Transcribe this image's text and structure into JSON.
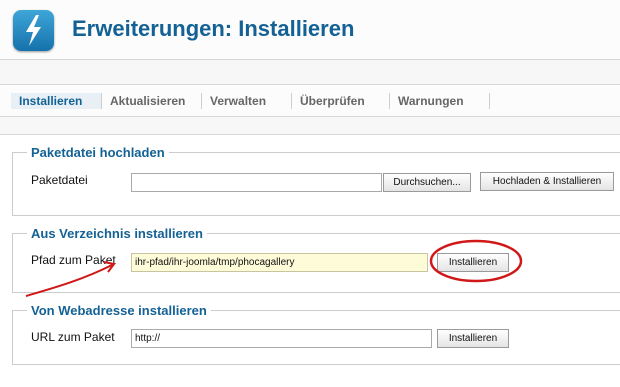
{
  "header": {
    "title": "Erweiterungen: Installieren",
    "icon": "extension-lightning-icon"
  },
  "tabs": [
    {
      "label": "Installieren",
      "active": true
    },
    {
      "label": "Aktualisieren",
      "active": false
    },
    {
      "label": "Verwalten",
      "active": false
    },
    {
      "label": "Überprüfen",
      "active": false
    },
    {
      "label": "Warnungen",
      "active": false
    }
  ],
  "upload": {
    "legend": "Paketdatei hochladen",
    "label": "Paketdatei",
    "value": "",
    "browse_label": "Durchsuchen...",
    "submit_label": "Hochladen & Installieren"
  },
  "directory": {
    "legend": "Aus Verzeichnis installieren",
    "label": "Pfad zum Paket",
    "value": "ihr-pfad/ihr-joomla/tmp/phocagallery",
    "submit_label": "Installieren"
  },
  "url": {
    "legend": "Von Webadresse installieren",
    "label": "URL zum Paket",
    "value": "http://",
    "submit_label": "Installieren"
  },
  "colors": {
    "accent": "#146295",
    "annotation": "#d01818",
    "highlight_field": "#fefbd8"
  }
}
